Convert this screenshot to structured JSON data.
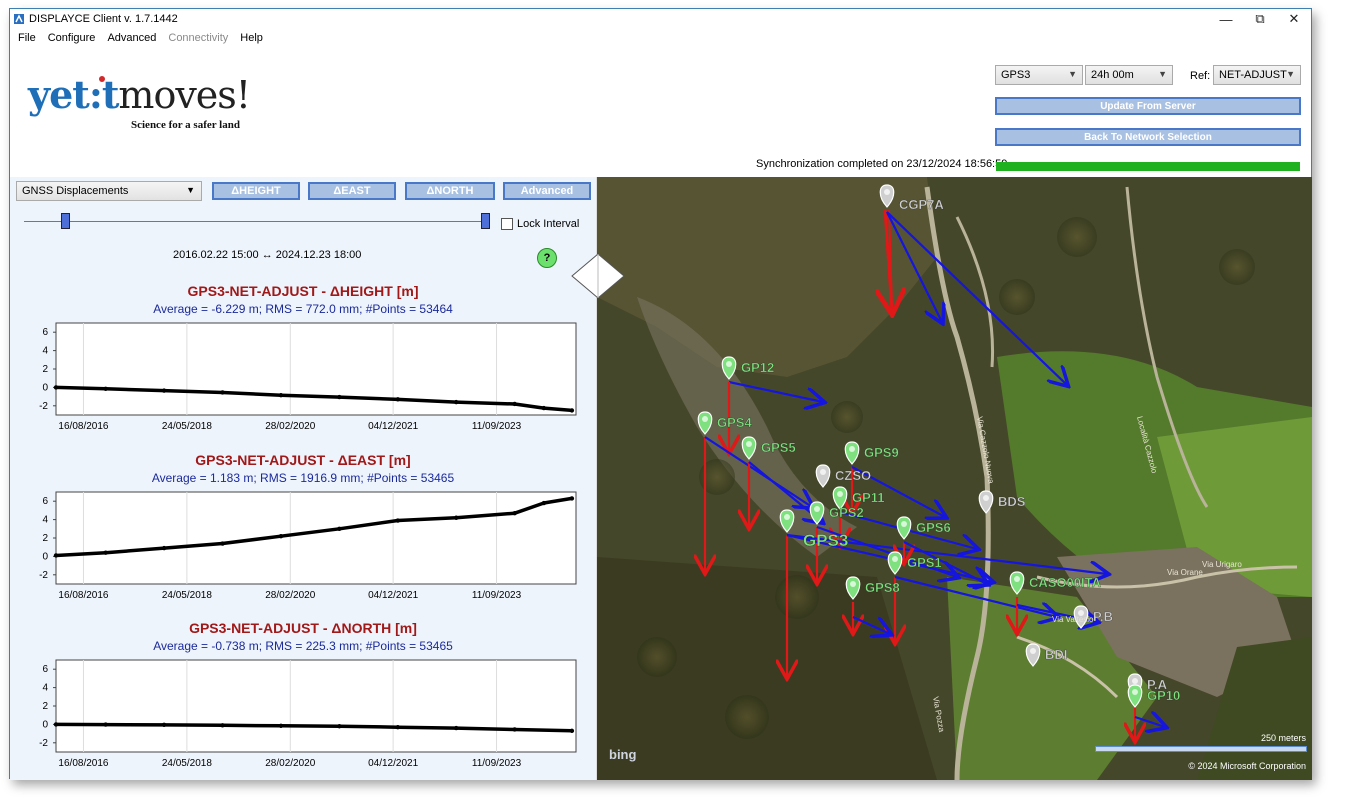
{
  "window": {
    "title": "DISPLAYCE Client v. 1.7.1442"
  },
  "menu": [
    {
      "label": "File",
      "enabled": true
    },
    {
      "label": "Configure",
      "enabled": true
    },
    {
      "label": "Advanced",
      "enabled": true
    },
    {
      "label": "Connectivity",
      "enabled": false
    },
    {
      "label": "Help",
      "enabled": true
    }
  ],
  "logo": {
    "brand_a": "yet",
    "brand_b": ":t",
    "brand_c": "moves!",
    "tagline": "Science for a safer land"
  },
  "controls": {
    "station": "GPS3",
    "period": "24h 00m",
    "ref_label": "Ref:",
    "ref_station": "NET-ADJUST",
    "update_btn": "Update From Server",
    "back_btn": "Back To Network Selection",
    "sync_text": "Synchronization completed on 23/12/2024 18:56:59",
    "sync_progress": 1.0
  },
  "left": {
    "mode": "GNSS Displacements",
    "buttons": [
      "ΔHEIGHT",
      "ΔEAST",
      "ΔNORTH",
      "Advanced"
    ],
    "lock_label": "Lock Interval",
    "interval": "2016.02.22 15:00 ↔ 2024.12.23 18:00",
    "help": "?"
  },
  "charts": [
    {
      "title": "GPS3-NET-ADJUST - ΔHEIGHT [m]",
      "subtitle": "Average = -6.229 m; RMS = 772.0 mm; #Points = 53464"
    },
    {
      "title": "GPS3-NET-ADJUST - ΔEAST [m]",
      "subtitle": "Average = 1.183 m; RMS = 1916.9 mm; #Points = 53465"
    },
    {
      "title": "GPS3-NET-ADJUST - ΔNORTH [m]",
      "subtitle": "Average = -0.738 m; RMS = 225.3 mm; #Points = 53465"
    }
  ],
  "chart_data": [
    {
      "type": "scatter",
      "title": "GPS3-NET-ADJUST - ΔHEIGHT [m]",
      "ylim": [
        -3,
        7
      ],
      "yticks": [
        "6",
        "4",
        "2",
        "0",
        "-2"
      ],
      "xticks": [
        "16/08/2016",
        "24/05/2018",
        "28/02/2020",
        "04/12/2021",
        "11/09/2023"
      ],
      "x": [
        2016.15,
        2017.0,
        2018.0,
        2019.0,
        2020.0,
        2021.0,
        2022.0,
        2023.0,
        2024.0,
        2024.5,
        2024.98
      ],
      "y": [
        0.0,
        -0.15,
        -0.35,
        -0.55,
        -0.85,
        -1.05,
        -1.3,
        -1.6,
        -1.8,
        -2.25,
        -2.5
      ]
    },
    {
      "type": "scatter",
      "title": "GPS3-NET-ADJUST - ΔEAST [m]",
      "ylim": [
        -3,
        7
      ],
      "yticks": [
        "6",
        "4",
        "2",
        "0",
        "-2"
      ],
      "xticks": [
        "16/08/2016",
        "24/05/2018",
        "28/02/2020",
        "04/12/2021",
        "11/09/2023"
      ],
      "x": [
        2016.15,
        2017.0,
        2018.0,
        2019.0,
        2020.0,
        2021.0,
        2022.0,
        2023.0,
        2024.0,
        2024.5,
        2024.98
      ],
      "y": [
        0.1,
        0.4,
        0.9,
        1.4,
        2.2,
        3.0,
        3.9,
        4.2,
        4.7,
        5.8,
        6.3
      ]
    },
    {
      "type": "scatter",
      "title": "GPS3-NET-ADJUST - ΔNORTH [m]",
      "ylim": [
        -3,
        7
      ],
      "yticks": [
        "6",
        "4",
        "2",
        "0",
        "-2"
      ],
      "xticks": [
        "16/08/2016",
        "24/05/2018",
        "28/02/2020",
        "04/12/2021",
        "11/09/2023"
      ],
      "x": [
        2016.15,
        2017.0,
        2018.0,
        2019.0,
        2020.0,
        2021.0,
        2022.0,
        2023.0,
        2024.0,
        2024.98
      ],
      "y": [
        0.0,
        -0.02,
        -0.05,
        -0.1,
        -0.15,
        -0.2,
        -0.3,
        -0.4,
        -0.55,
        -0.7
      ]
    }
  ],
  "map": {
    "stations": [
      {
        "name": "CGP7A",
        "color": "gray"
      },
      {
        "name": "GP12",
        "color": "green"
      },
      {
        "name": "GPS4",
        "color": "green"
      },
      {
        "name": "GPS5",
        "color": "green"
      },
      {
        "name": "GPS9",
        "color": "green"
      },
      {
        "name": "CZSO",
        "color": "gray"
      },
      {
        "name": "GP11",
        "color": "green"
      },
      {
        "name": "GPS2",
        "color": "green"
      },
      {
        "name": "GPS3",
        "color": "green"
      },
      {
        "name": "GPS6",
        "color": "green"
      },
      {
        "name": "BDS",
        "color": "gray"
      },
      {
        "name": "GPS1",
        "color": "green"
      },
      {
        "name": "CASO00ITA",
        "color": "green"
      },
      {
        "name": "GPS8",
        "color": "green"
      },
      {
        "name": "P.B",
        "color": "gray"
      },
      {
        "name": "BDI",
        "color": "gray"
      },
      {
        "name": "P.A",
        "color": "gray"
      },
      {
        "name": "GP10",
        "color": "green"
      }
    ],
    "road_labels": [
      "Via Cazzolo Nuova",
      "Località Cazzolo",
      "Via Orane",
      "Via Urigaro",
      "Via Pozza",
      "Via Valtesio"
    ],
    "bing": "bing",
    "scale": "250 meters",
    "copyright": "© 2024 Microsoft Corporation"
  }
}
